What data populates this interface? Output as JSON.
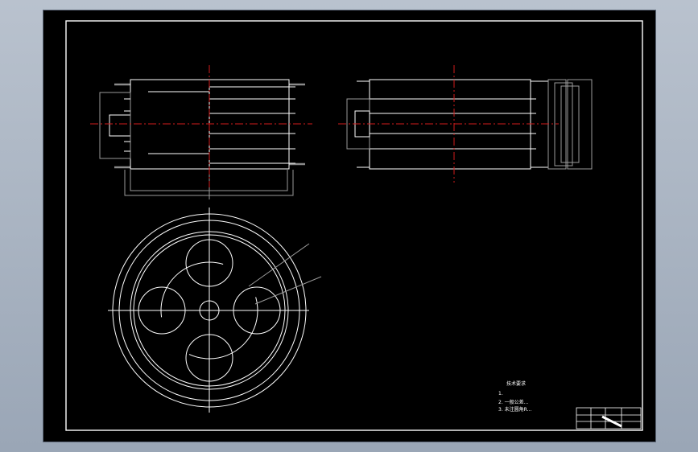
{
  "drawing": {
    "colors": {
      "background": "#000000",
      "linework": "#ffffff",
      "centerline": "#d21c1c",
      "dimension": "#9a9a9a",
      "hatch": "#8a8a8a"
    },
    "views": {
      "front_view": "front",
      "side_view": "side",
      "top_view": "top"
    },
    "notes": {
      "heading": "技术要求",
      "line1": "1.",
      "line2": "2. 一般公差...",
      "line3": "3. 未注圆角R..."
    },
    "title_block": {
      "cells": [
        "",
        "",
        "",
        "",
        "",
        ""
      ]
    }
  }
}
